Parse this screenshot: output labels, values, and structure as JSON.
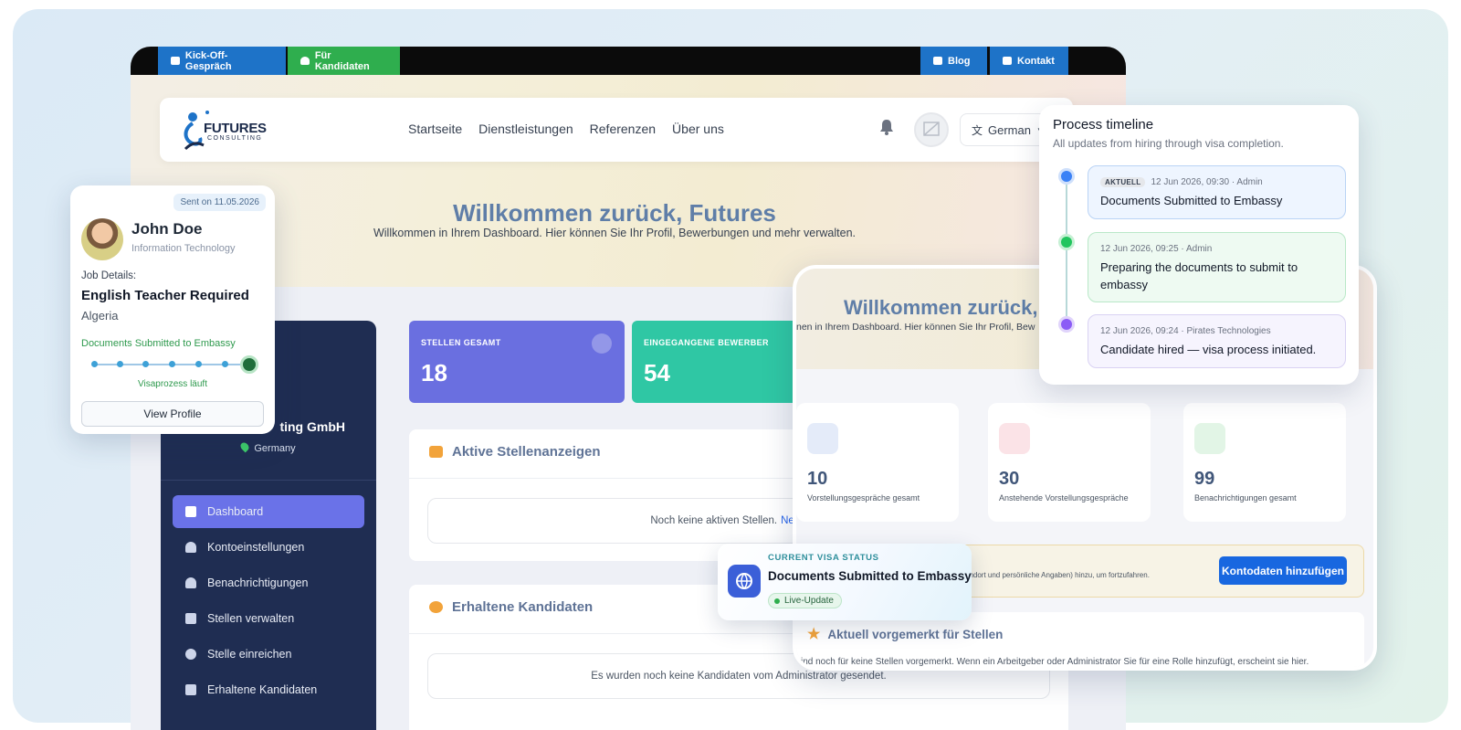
{
  "topbar": {
    "kickoff": "Kick-Off-Gespräch",
    "candidates": "Für Kandidaten",
    "blog": "Blog",
    "contact": "Kontakt"
  },
  "brand": {
    "name": "FUTURES",
    "sub": "CONSULTING"
  },
  "nav": {
    "links": [
      "Startseite",
      "Dienstleistungen",
      "Referenzen",
      "Über uns"
    ],
    "language": "German"
  },
  "hero": {
    "title": "Willkommen zurück, Futures",
    "subtitle": "Willkommen in Ihrem Dashboard. Hier können Sie Ihr Profil, Bewerbungen und mehr verwalten."
  },
  "sidebar": {
    "company": "ting GmbH",
    "country": "Germany",
    "items": [
      {
        "label": "Dashboard"
      },
      {
        "label": "Kontoeinstellungen"
      },
      {
        "label": "Benachrichtigungen"
      },
      {
        "label": "Stellen verwalten"
      },
      {
        "label": "Stelle einreichen"
      },
      {
        "label": "Erhaltene Kandidaten"
      }
    ]
  },
  "stats": [
    {
      "label": "STELLEN GESAMT",
      "value": "18",
      "color": "#6a6fe0"
    },
    {
      "label": "EINGEGANGENE BEWERBER",
      "value": "54",
      "color": "#2fc7a4"
    }
  ],
  "panels": {
    "jobs": {
      "title": "Aktive Stellenanzeigen",
      "empty": "Noch keine aktiven Stellen.",
      "link": "Neue Stel"
    },
    "candidates": {
      "title": "Erhaltene Kandidaten",
      "empty": "Es wurden noch keine Kandidaten vom Administrator gesendet."
    }
  },
  "candidate_card": {
    "sent": "Sent on 11.05.2026",
    "name": "John Doe",
    "department": "Information Technology",
    "job_details_label": "Job Details:",
    "job_title": "English Teacher Required",
    "location": "Algeria",
    "status": "Documents Submitted to Embassy",
    "step": "Visaprozess läuft",
    "view_button": "View Profile"
  },
  "mobile": {
    "welcome": "Willkommen zurück, F",
    "subtitle": "nen in Ihrem Dashboard. Hier können Sie Ihr Profil, Bew",
    "stats": [
      {
        "value": "10",
        "label": "Vorstellungsgespräche gesamt",
        "color": "#3b6fe0"
      },
      {
        "value": "30",
        "label": "Anstehende Vorstellungsgespräche",
        "color": "#2fae4e"
      },
      {
        "value": "99",
        "label": "Benachrichtigungen gesamt",
        "color": "#2fae4e"
      }
    ],
    "warning_text": "andort und persönliche Angaben) hinzu, um fortzufahren.",
    "warning_button": "Kontodaten hinzufügen",
    "vorgemerkt_title": "Aktuell vorgemerkt für Stellen",
    "vorgemerkt_text": "sind noch für keine Stellen vorgemerkt. Wenn ein Arbeitgeber oder Administrator Sie für eine Rolle hinzufügt, erscheint sie hier."
  },
  "visa": {
    "label": "CURRENT VISA STATUS",
    "value": "Documents Submitted to Embassy",
    "live": "Live-Update"
  },
  "timeline": {
    "title": "Process timeline",
    "subtitle": "All updates from hiring through visa completion.",
    "items": [
      {
        "badge": "AKTUELL",
        "meta": "12 Jun 2026, 09:30 · Admin",
        "text": "Documents Submitted to Embassy"
      },
      {
        "meta": "12 Jun 2026, 09:25 · Admin",
        "text": "Preparing the documents to submit to embassy"
      },
      {
        "meta": "12 Jun 2026, 09:24 · Pirates Technologies",
        "text": "Candidate hired — visa process initiated."
      }
    ]
  }
}
